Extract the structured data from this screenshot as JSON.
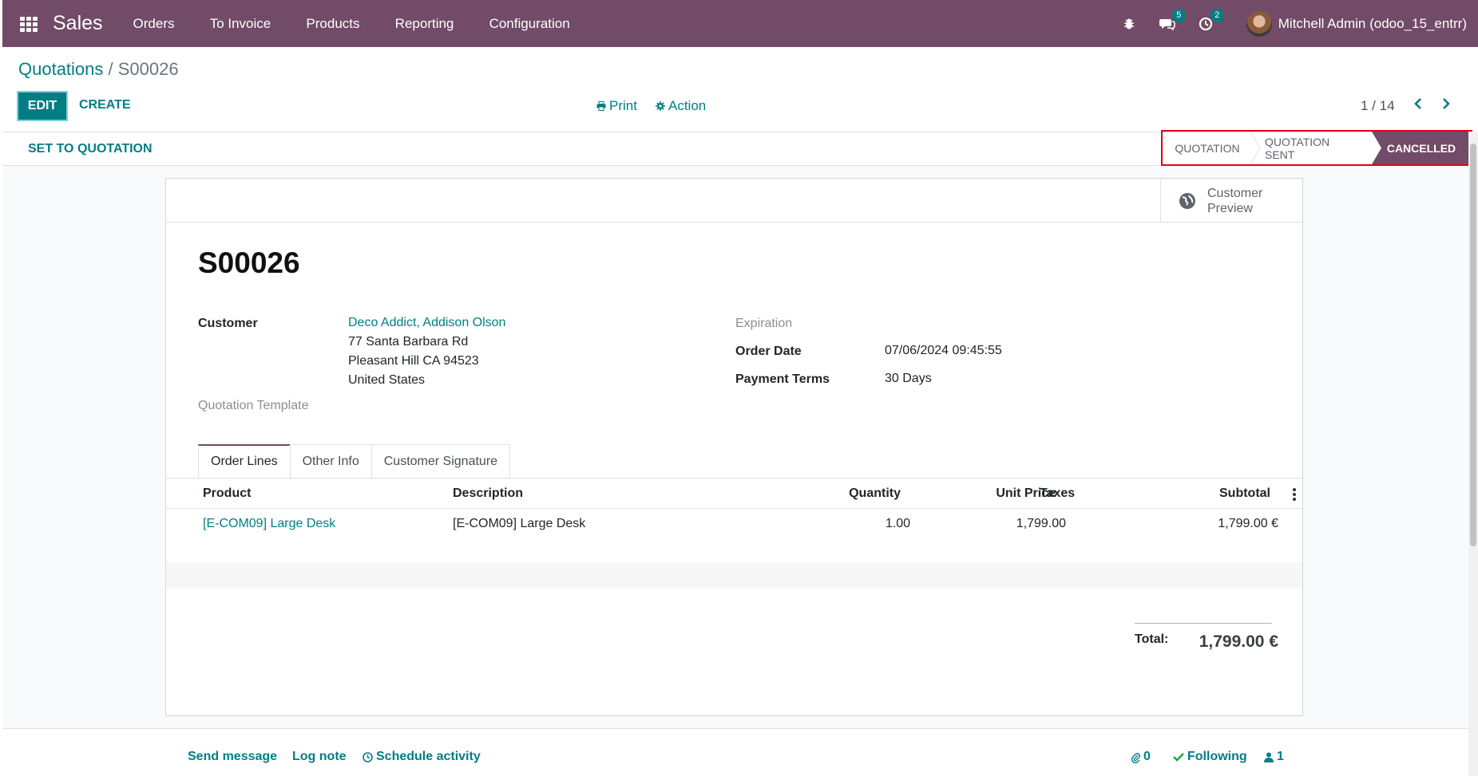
{
  "navbar": {
    "app_name": "Sales",
    "menu": [
      "Orders",
      "To Invoice",
      "Products",
      "Reporting",
      "Configuration"
    ],
    "messages_count": "5",
    "activities_count": "2",
    "user": "Mitchell Admin (odoo_15_entrr)"
  },
  "breadcrumb": {
    "parent": "Quotations",
    "separator": " / ",
    "current": "S00026"
  },
  "toolbar": {
    "edit": "EDIT",
    "create": "CREATE",
    "print": "Print",
    "action": "Action",
    "pager": "1 / 14"
  },
  "statusbar": {
    "action_button": "SET TO QUOTATION",
    "stages": [
      "QUOTATION",
      "QUOTATION SENT",
      "CANCELLED"
    ],
    "active_stage": "CANCELLED"
  },
  "buttonbox": {
    "preview_line1": "Customer",
    "preview_line2": "Preview"
  },
  "record": {
    "name": "S00026",
    "customer_label": "Customer",
    "customer_name": "Deco Addict, Addison Olson",
    "address_line1": "77 Santa Barbara Rd",
    "address_line2": "Pleasant Hill CA 94523",
    "address_line3": "United States",
    "template_label": "Quotation Template",
    "expiration_label": "Expiration",
    "order_date_label": "Order Date",
    "order_date": "07/06/2024 09:45:55",
    "payment_terms_label": "Payment Terms",
    "payment_terms": "30 Days"
  },
  "tabs": [
    "Order Lines",
    "Other Info",
    "Customer Signature"
  ],
  "table": {
    "columns": [
      "Product",
      "Description",
      "Quantity",
      "Unit Price",
      "Taxes",
      "Subtotal"
    ],
    "rows": [
      {
        "product": "[E-COM09] Large Desk",
        "description": "[E-COM09] Large Desk",
        "quantity": "1.00",
        "unit_price": "1,799.00",
        "taxes": "",
        "subtotal": "1,799.00 €"
      }
    ]
  },
  "totals": {
    "label": "Total:",
    "value": "1,799.00 €"
  },
  "chatter": {
    "send_message": "Send message",
    "log_note": "Log note",
    "schedule_activity": "Schedule activity",
    "attachments": "0",
    "following": "Following",
    "followers": "1"
  },
  "colors": {
    "brand": "#714b67",
    "accent": "#017e84",
    "highlight": "#e0001b"
  }
}
